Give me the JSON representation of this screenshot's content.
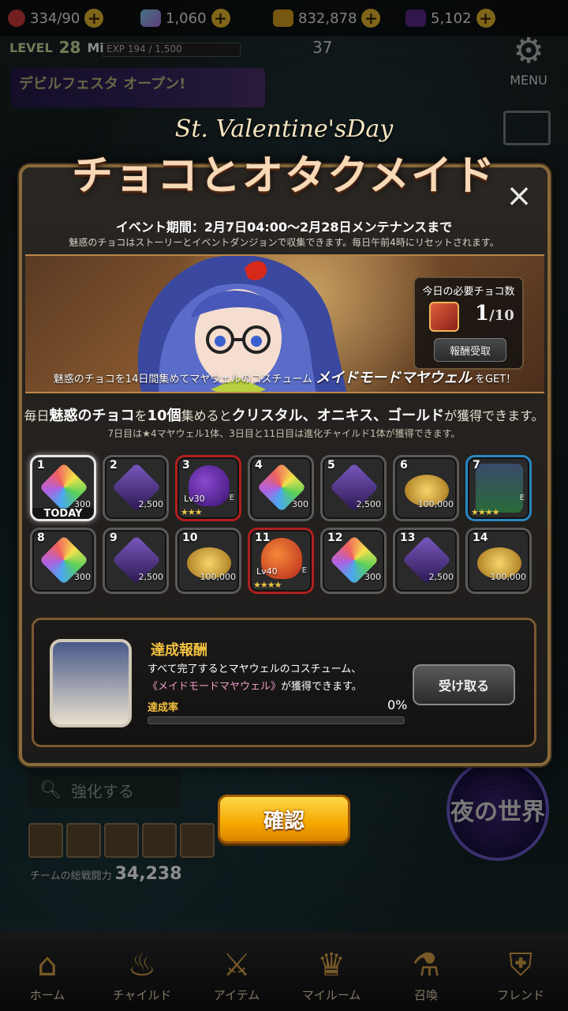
{
  "status": {
    "stamina": "334/90",
    "crystal": "1,060",
    "gold": "832,878",
    "onyx": "5,102",
    "level_label": "LEVEL",
    "level": "28",
    "player_name": "Miku",
    "exp": "EXP 194 / 1,500",
    "side_count": "37",
    "menu_label": "MENU"
  },
  "background": {
    "festa_banner": "デビルフェスタ オープン!",
    "search_label": "強化する",
    "power_label": "チームの総戦闘力",
    "power_value": "34,238",
    "night_world": "夜の世界"
  },
  "modal": {
    "title_sub": "St. Valentine'sDay",
    "title_main": "チョコとオタクメイド",
    "close_icon": "×",
    "period": "イベント期間：2月7日04:00〜2月28日メンテナンスまで",
    "period_note": "魅惑のチョコはストーリーとイベントダンジョンで収集できます。毎日午前4時にリセットされます。",
    "need_label": "今日の必要チョコ数",
    "need_current": "1",
    "need_total": "/10",
    "need_button": "報酬受取",
    "hero_caption_pre": "魅惑のチョコを14日間集めてマヤウェルのコスチューム",
    "hero_caption_em": "メイドモードマヤウェル",
    "hero_caption_post": "をGET！",
    "info1_pre": "毎日",
    "info1_b1": "魅惑のチョコ",
    "info1_mid1": "を",
    "info1_b2": "10個",
    "info1_mid2": "集めると",
    "info1_b3": "クリスタル、オニキス、ゴールド",
    "info1_post": "が獲得できます。",
    "info2": "7日目は★4マヤウェル1体、3日目と11日目は進化チャイルド1体が獲得できます。",
    "days": [
      {
        "day": "1",
        "amount": "300",
        "today": "TODAY"
      },
      {
        "day": "2",
        "amount": "2,500"
      },
      {
        "day": "3",
        "lv": "Lv30",
        "eb": "E",
        "stars": "★★★"
      },
      {
        "day": "4",
        "amount": "300"
      },
      {
        "day": "5",
        "amount": "2,500"
      },
      {
        "day": "6",
        "amount": "100,000"
      },
      {
        "day": "7",
        "eb": "E",
        "stars": "★★★★"
      },
      {
        "day": "8",
        "amount": "300"
      },
      {
        "day": "9",
        "amount": "2,500"
      },
      {
        "day": "10",
        "amount": "100,000"
      },
      {
        "day": "11",
        "lv": "Lv40",
        "eb": "E",
        "stars": "★★★★"
      },
      {
        "day": "12",
        "amount": "300"
      },
      {
        "day": "13",
        "amount": "2,500"
      },
      {
        "day": "14",
        "amount": "100,000"
      }
    ],
    "reward_title": "達成報酬",
    "reward_line1": "すべて完了するとマヤウェルのコスチューム、",
    "reward_line2_pink": "《メイドモードマヤウェル》",
    "reward_line2_post": "が獲得できます。",
    "rate_label": "達成率",
    "rate_value": "0%",
    "rate_fraction": 0,
    "claim_button": "受け取る",
    "confirm_button": "確認"
  },
  "nav": [
    {
      "label": "ホーム",
      "icon": "home-icon"
    },
    {
      "label": "チャイルド",
      "icon": "flame-icon"
    },
    {
      "label": "アイテム",
      "icon": "sword-shield-icon"
    },
    {
      "label": "マイルーム",
      "icon": "crown-icon"
    },
    {
      "label": "召喚",
      "icon": "potion-icon"
    },
    {
      "label": "フレンド",
      "icon": "shield-icon"
    }
  ]
}
